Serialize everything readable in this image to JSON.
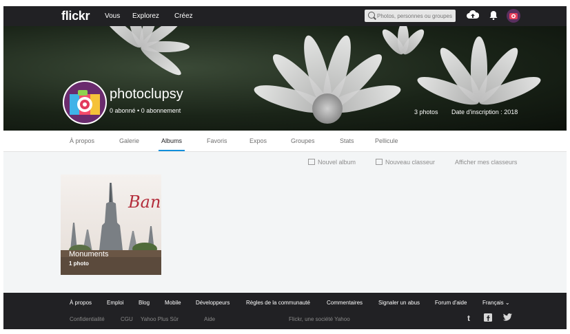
{
  "topnav": {
    "logo": "flickr",
    "links": [
      "Vous",
      "Explorez",
      "Créez"
    ],
    "search_placeholder": "Photos, personnes ou groupes"
  },
  "profile": {
    "username": "photoclupsy",
    "followers": "0 abonné • 0 abonnement",
    "photos": "3 photos",
    "joined": "Date d'inscription : 2018"
  },
  "tabs": [
    "À propos",
    "Galerie",
    "Albums",
    "Favoris",
    "Expos",
    "Groupes",
    "Stats",
    "Pellicule"
  ],
  "active_tab": "Albums",
  "actions": {
    "new_album": "Nouvel album",
    "new_collection": "Nouveau classeur",
    "show_collections": "Afficher mes classeurs"
  },
  "album": {
    "title": "Monuments",
    "count": "1 photo",
    "banner_text": "Ban"
  },
  "footer": {
    "links": [
      "À propos",
      "Emploi",
      "Blog",
      "Mobile",
      "Développeurs",
      "Règles de la communauté",
      "Commentaires",
      "Signaler un abus",
      "Forum d'aide",
      "Français ⌄"
    ],
    "links2": [
      "Confidentialité",
      "CGU",
      "Yahoo Plus Sûr",
      "Aide"
    ],
    "company": "Flickr, une société Yahoo",
    "social": [
      "t",
      "f",
      "y"
    ]
  },
  "colors": {
    "accent": "#128fdc",
    "nav_bg": "#212124",
    "footer_bg": "#212124"
  }
}
